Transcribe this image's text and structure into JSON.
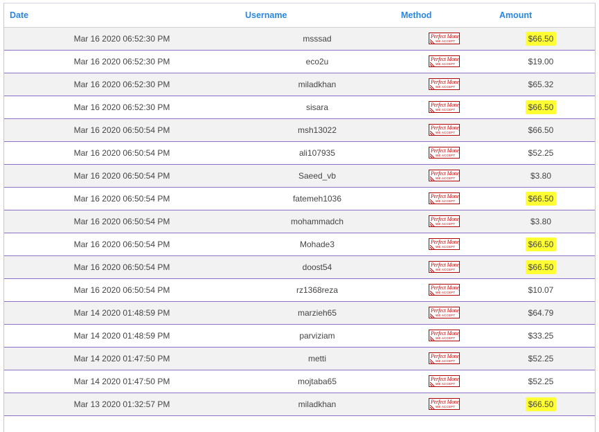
{
  "table": {
    "headers": {
      "date": "Date",
      "username": "Username",
      "method": "Method",
      "amount": "Amount"
    },
    "method_logo": {
      "name": "perfect-money-logo",
      "top_text": "Perfect Money",
      "bottom_text": "WE ACCEPT",
      "color": "#c40000"
    },
    "highlight_color": "#ffff33",
    "rows": [
      {
        "date": "Mar 16 2020 06:52:30 PM",
        "username": "msssad",
        "amount": "$66.50",
        "highlighted": true
      },
      {
        "date": "Mar 16 2020 06:52:30 PM",
        "username": "eco2u",
        "amount": "$19.00",
        "highlighted": false
      },
      {
        "date": "Mar 16 2020 06:52:30 PM",
        "username": "miladkhan",
        "amount": "$65.32",
        "highlighted": false
      },
      {
        "date": "Mar 16 2020 06:52:30 PM",
        "username": "sisara",
        "amount": "$66.50",
        "highlighted": true
      },
      {
        "date": "Mar 16 2020 06:50:54 PM",
        "username": "msh13022",
        "amount": "$66.50",
        "highlighted": false
      },
      {
        "date": "Mar 16 2020 06:50:54 PM",
        "username": "ali107935",
        "amount": "$52.25",
        "highlighted": false
      },
      {
        "date": "Mar 16 2020 06:50:54 PM",
        "username": "Saeed_vb",
        "amount": "$3.80",
        "highlighted": false
      },
      {
        "date": "Mar 16 2020 06:50:54 PM",
        "username": "fatemeh1036",
        "amount": "$66.50",
        "highlighted": true
      },
      {
        "date": "Mar 16 2020 06:50:54 PM",
        "username": "mohammadch",
        "amount": "$3.80",
        "highlighted": false
      },
      {
        "date": "Mar 16 2020 06:50:54 PM",
        "username": "Mohade3",
        "amount": "$66.50",
        "highlighted": true
      },
      {
        "date": "Mar 16 2020 06:50:54 PM",
        "username": "doost54",
        "amount": "$66.50",
        "highlighted": true
      },
      {
        "date": "Mar 16 2020 06:50:54 PM",
        "username": "rz1368reza",
        "amount": "$10.07",
        "highlighted": false
      },
      {
        "date": "Mar 14 2020 01:48:59 PM",
        "username": "marzieh65",
        "amount": "$64.79",
        "highlighted": false
      },
      {
        "date": "Mar 14 2020 01:48:59 PM",
        "username": "parviziam",
        "amount": "$33.25",
        "highlighted": false
      },
      {
        "date": "Mar 14 2020 01:47:50 PM",
        "username": "metti",
        "amount": "$52.25",
        "highlighted": false
      },
      {
        "date": "Mar 14 2020 01:47:50 PM",
        "username": "mojtaba65",
        "amount": "$52.25",
        "highlighted": false
      },
      {
        "date": "Mar 13 2020 01:32:57 PM",
        "username": "miladkhan",
        "amount": "$66.50",
        "highlighted": true
      }
    ]
  }
}
